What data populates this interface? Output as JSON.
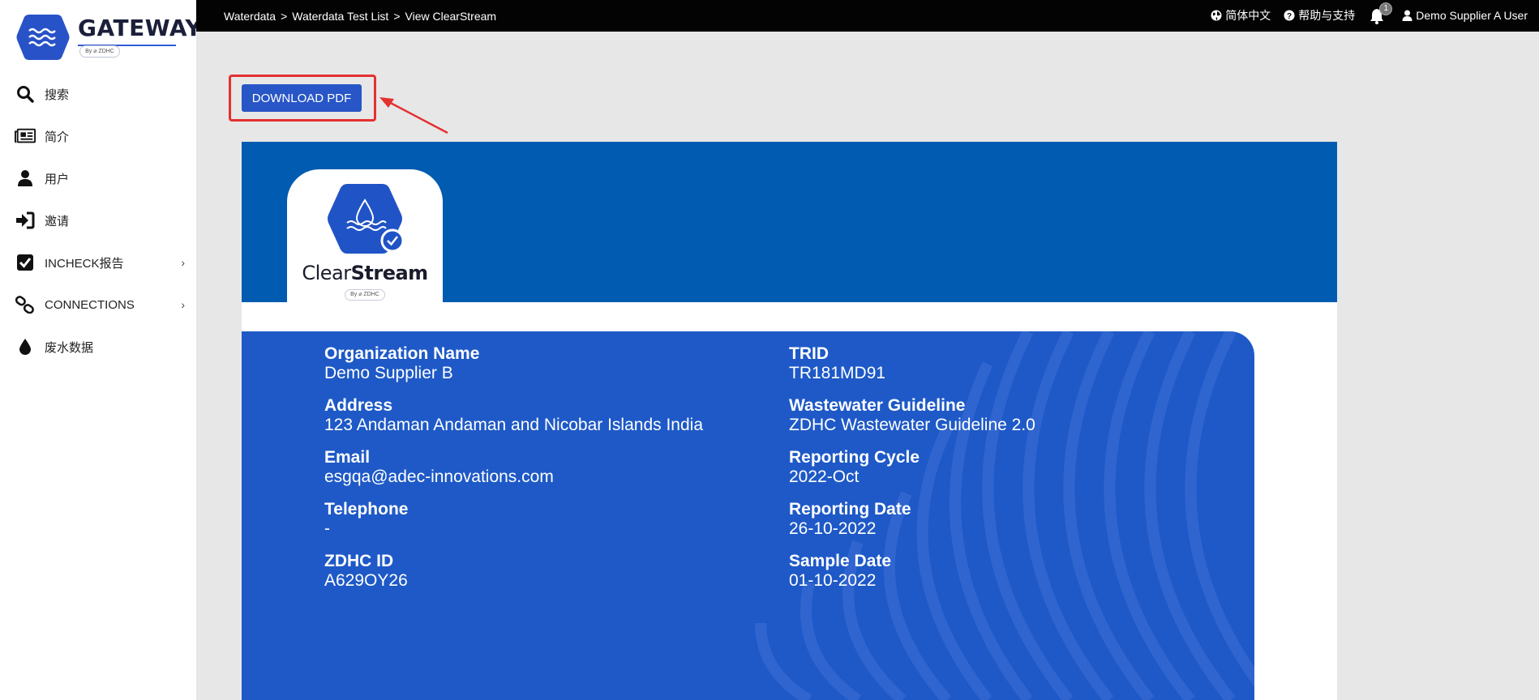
{
  "sidebar": {
    "logo": {
      "word": "GATEWAY",
      "by": "By ⌀ ZDHC"
    },
    "items": [
      {
        "label": "搜索",
        "icon": "search-icon",
        "expandable": false
      },
      {
        "label": "简介",
        "icon": "newspaper-icon",
        "expandable": false
      },
      {
        "label": "用户",
        "icon": "user-icon",
        "expandable": false
      },
      {
        "label": "邀请",
        "icon": "sign-in-icon",
        "expandable": false
      },
      {
        "label": "INCHECK报告",
        "icon": "checkbox-icon",
        "expandable": true
      },
      {
        "label": "CONNECTIONS",
        "icon": "link-icon",
        "expandable": true
      },
      {
        "label": "废水数据",
        "icon": "drop-icon",
        "expandable": false
      }
    ]
  },
  "topbar": {
    "breadcrumbs": [
      "Waterdata",
      "Waterdata Test List",
      "View ClearStream"
    ],
    "separator": ">",
    "language": "简体中文",
    "help": "帮助与支持",
    "notification_count": "1",
    "user": "Demo Supplier A User"
  },
  "main": {
    "download_label": "DOWNLOAD PDF",
    "logo": {
      "word_light": "Clear",
      "word_bold": "Stream",
      "by": "By ⌀ ZDHC"
    },
    "left_fields": [
      {
        "label": "Organization Name",
        "value": "Demo Supplier B"
      },
      {
        "label": "Address",
        "value": "123 Andaman Andaman and Nicobar Islands India"
      },
      {
        "label": "Email",
        "value": "esgqa@adec-innovations.com"
      },
      {
        "label": "Telephone",
        "value": "-"
      },
      {
        "label": "ZDHC ID",
        "value": "A629OY26"
      }
    ],
    "right_fields": [
      {
        "label": "TRID",
        "value": "TR181MD91"
      },
      {
        "label": "Wastewater Guideline",
        "value": "ZDHC Wastewater Guideline 2.0"
      },
      {
        "label": "Reporting Cycle",
        "value": "2022-Oct"
      },
      {
        "label": "Reporting Date",
        "value": "26-10-2022"
      },
      {
        "label": "Sample Date",
        "value": "01-10-2022"
      }
    ]
  },
  "colors": {
    "header_blue": "#005bb1",
    "panel_blue": "#1e59c7",
    "button_blue": "#2856c6",
    "highlight_red": "#e53030",
    "topbar": "#030303"
  }
}
